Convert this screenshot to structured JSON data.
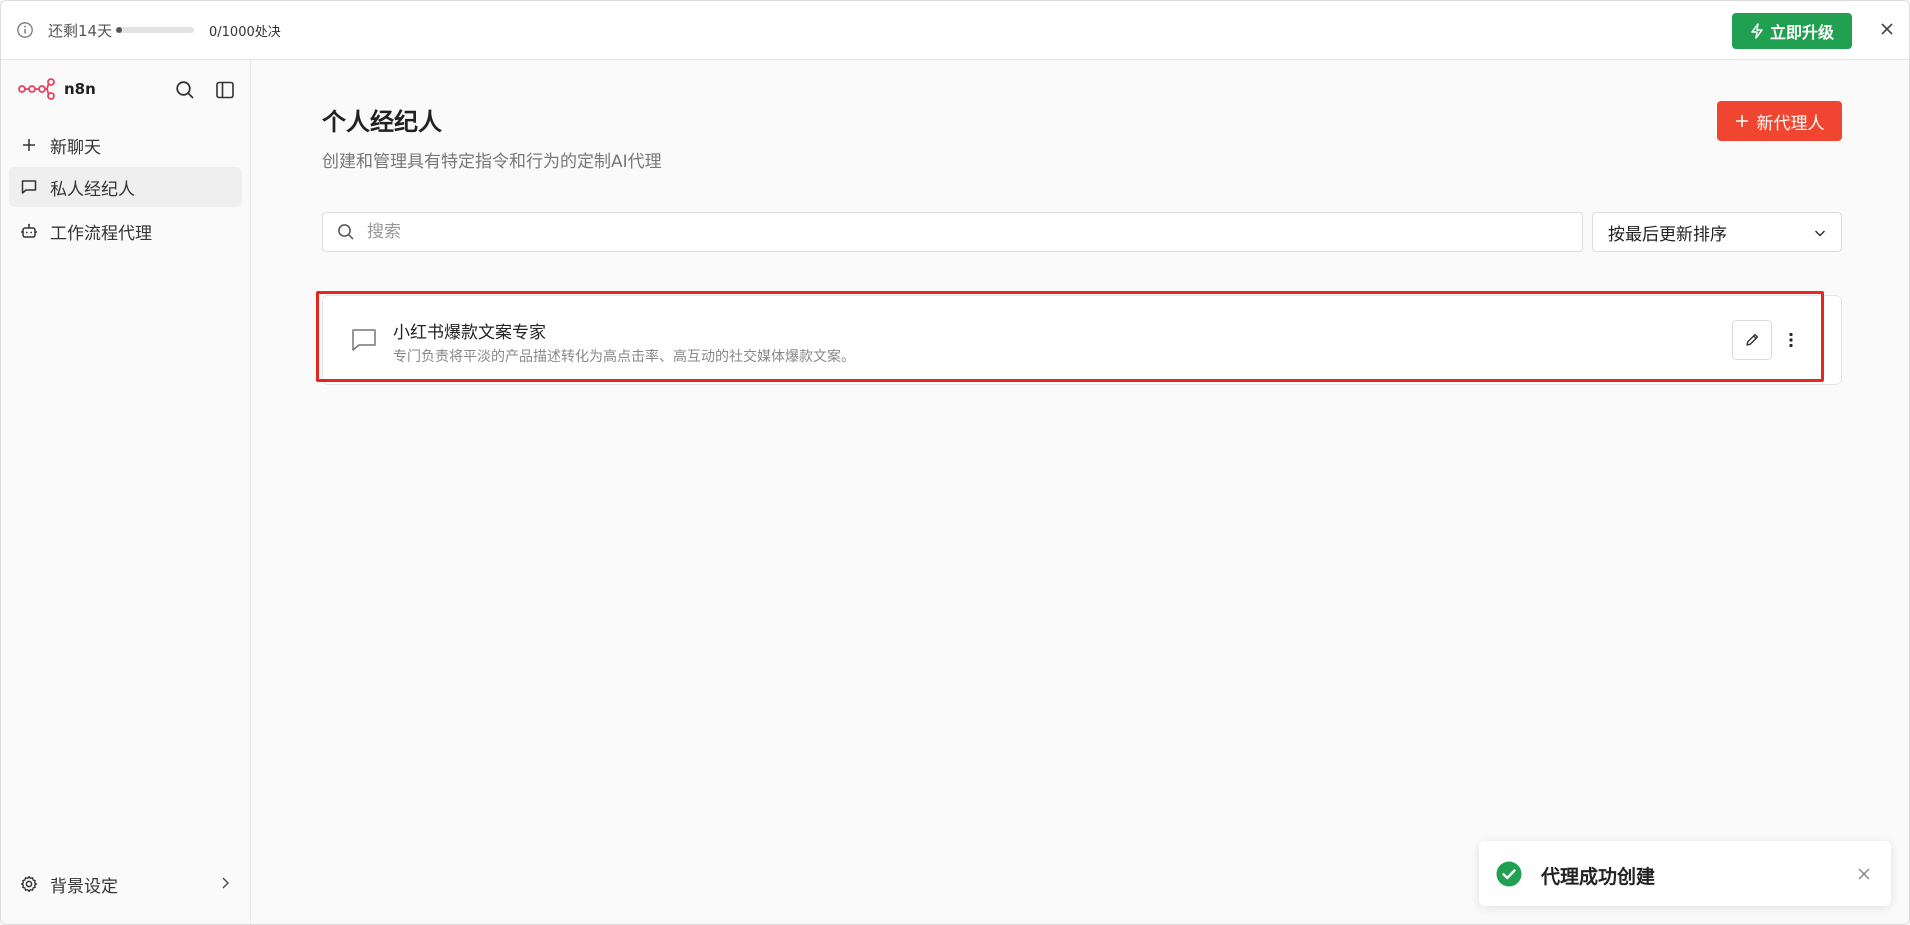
{
  "banner": {
    "trial_text": "还剩14天",
    "trial_progress": 0.02,
    "executions_text": "0/1000处决",
    "upgrade_label": "立即升级",
    "upgrade_color": "#22a052"
  },
  "sidebar": {
    "brand": "n8n",
    "items": [
      {
        "label": "新聊天",
        "icon": "plus-icon"
      },
      {
        "label": "私人经纪人",
        "icon": "chat-bubble-icon"
      },
      {
        "label": "工作流程代理",
        "icon": "robot-icon"
      }
    ],
    "settings_label": "背景设定"
  },
  "main": {
    "title": "个人经纪人",
    "subtitle": "创建和管理具有特定指令和行为的定制AI代理",
    "new_agent_label": "新代理人",
    "new_agent_color": "#f04631",
    "search_placeholder": "搜索",
    "sort_label": "按最后更新排序",
    "agents": [
      {
        "name": "小红书爆款文案专家",
        "description": "专门负责将平淡的产品描述转化为高点击率、高互动的社交媒体爆款文案。"
      }
    ]
  },
  "toast": {
    "message": "代理成功创建",
    "status_color": "#22a052"
  }
}
